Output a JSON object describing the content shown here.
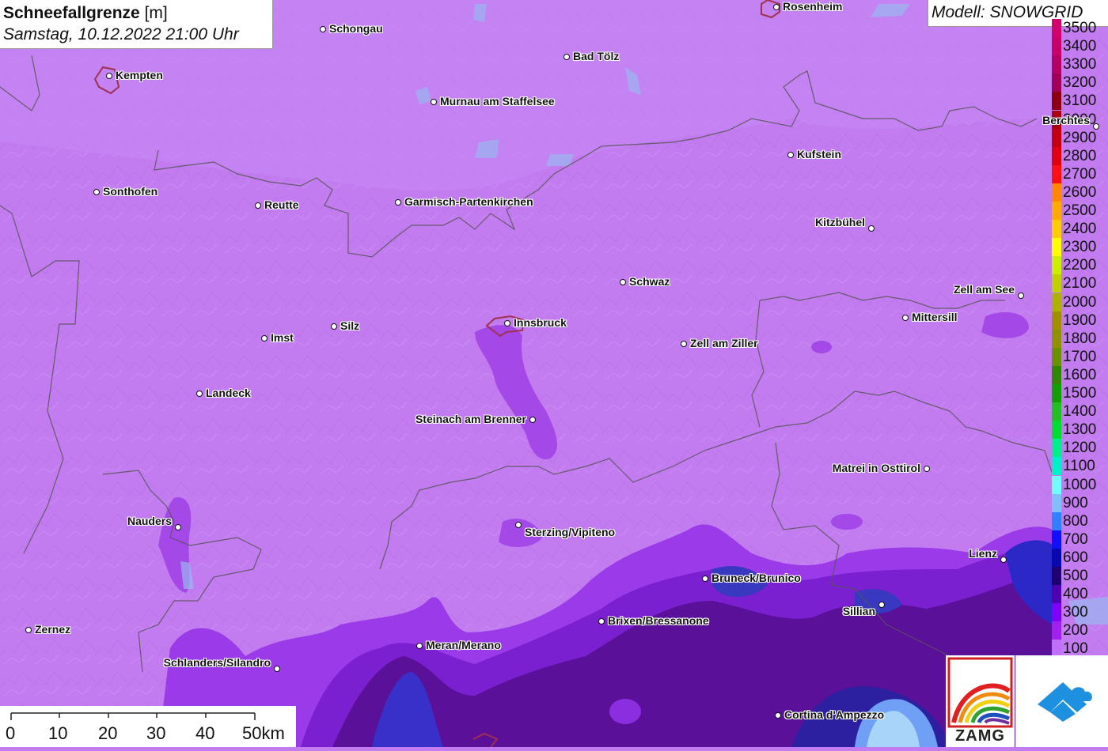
{
  "title": {
    "variable": "Schneefallgrenze",
    "unit": "[m]",
    "datetime": "Samstag, 10.12.2022 21:00 Uhr"
  },
  "model": "Modell: SNOWGRID",
  "legend": {
    "levels": [
      {
        "label": "3500",
        "color": "#d4006e"
      },
      {
        "label": "3400",
        "color": "#c8006a"
      },
      {
        "label": "3300",
        "color": "#b40064"
      },
      {
        "label": "3200",
        "color": "#a0005a"
      },
      {
        "label": "3100",
        "color": "#8c0010"
      },
      {
        "label": "3000",
        "color": "#a80010"
      },
      {
        "label": "2900",
        "color": "#c40010"
      },
      {
        "label": "2800",
        "color": "#e00010"
      },
      {
        "label": "2700",
        "color": "#ff1010"
      },
      {
        "label": "2600",
        "color": "#ff8800"
      },
      {
        "label": "2500",
        "color": "#ffaa00"
      },
      {
        "label": "2400",
        "color": "#ffcc00"
      },
      {
        "label": "2300",
        "color": "#ffff00"
      },
      {
        "label": "2200",
        "color": "#ccee00"
      },
      {
        "label": "2100",
        "color": "#c0d000"
      },
      {
        "label": "2000",
        "color": "#b0b000"
      },
      {
        "label": "1900",
        "color": "#a09000"
      },
      {
        "label": "1800",
        "color": "#909000"
      },
      {
        "label": "1700",
        "color": "#6c9000"
      },
      {
        "label": "1600",
        "color": "#308800"
      },
      {
        "label": "1500",
        "color": "#10a000"
      },
      {
        "label": "1400",
        "color": "#20c020"
      },
      {
        "label": "1300",
        "color": "#00dd30"
      },
      {
        "label": "1200",
        "color": "#00ee90"
      },
      {
        "label": "1100",
        "color": "#00f0c8"
      },
      {
        "label": "1000",
        "color": "#70ffff"
      },
      {
        "label": "900",
        "color": "#80c0f8"
      },
      {
        "label": "800",
        "color": "#3080ff"
      },
      {
        "label": "700",
        "color": "#1010ff"
      },
      {
        "label": "600",
        "color": "#0808b0"
      },
      {
        "label": "500",
        "color": "#200070"
      },
      {
        "label": "400",
        "color": "#5000b0"
      },
      {
        "label": "300",
        "color": "#8000ff"
      },
      {
        "label": "200",
        "color": "#a020f0"
      },
      {
        "label": "100",
        "color": "#c070f8"
      }
    ]
  },
  "scalebar": {
    "labels": [
      "0",
      "10",
      "20",
      "30",
      "40",
      "50km"
    ]
  },
  "cities": [
    {
      "name": "Rosenheim"
    },
    {
      "name": "Schongau"
    },
    {
      "name": "Bad Tölz"
    },
    {
      "name": "Kempten"
    },
    {
      "name": "Murnau am Staffelsee"
    },
    {
      "name": "Berchtes"
    },
    {
      "name": "Kufstein"
    },
    {
      "name": "Sonthofen"
    },
    {
      "name": "Reutte"
    },
    {
      "name": "Garmisch-Partenkirchen"
    },
    {
      "name": "Kitzbühel"
    },
    {
      "name": "Schwaz"
    },
    {
      "name": "Zell am See"
    },
    {
      "name": "Mittersill"
    },
    {
      "name": "Silz"
    },
    {
      "name": "Innsbruck"
    },
    {
      "name": "Imst"
    },
    {
      "name": "Zell am Ziller"
    },
    {
      "name": "Landeck"
    },
    {
      "name": "Steinach am Brenner"
    },
    {
      "name": "Matrei in Osttirol"
    },
    {
      "name": "Nauders"
    },
    {
      "name": "Sterzing/Vipiteno"
    },
    {
      "name": "Lienz"
    },
    {
      "name": "Bruneck/Brunico"
    },
    {
      "name": "Sillian"
    },
    {
      "name": "Brixen/Bressanone"
    },
    {
      "name": "Zernez"
    },
    {
      "name": "Meran/Merano"
    },
    {
      "name": "Schlanders/Silandro"
    },
    {
      "name": "Cortina d'Ampezzo"
    }
  ],
  "logos": {
    "zamg": "ZAMG",
    "snowgrid": "snowgrid-cloud-icon"
  }
}
